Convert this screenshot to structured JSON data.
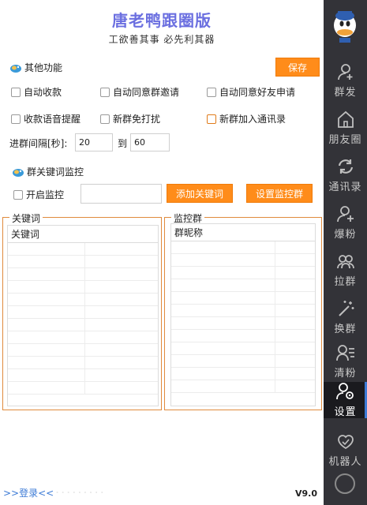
{
  "header": {
    "title": "唐老鸭跟圈版",
    "subtitle": "工欲善其事 必先利其器"
  },
  "other_functions": {
    "title": "其他功能",
    "save_label": "保存",
    "options": [
      {
        "label": "自动收款",
        "checked": false
      },
      {
        "label": "自动同意群邀请",
        "checked": false
      },
      {
        "label": "自动同意好友申请",
        "checked": false
      },
      {
        "label": "收款语音提醒",
        "checked": false
      },
      {
        "label": "新群免打扰",
        "checked": false
      },
      {
        "label": "新群加入通讯录",
        "checked": false
      }
    ],
    "interval_label": "进群间隔[秒]:",
    "interval_from": "20",
    "interval_to_label": "到",
    "interval_to": "60"
  },
  "keyword_monitor": {
    "title": "群关键词监控",
    "enable_label": "开启监控",
    "keyword_input": "",
    "add_keyword_label": "添加关键词",
    "set_group_label": "设置监控群"
  },
  "keywords_group": {
    "title": "关键词",
    "column": "关键词"
  },
  "monitor_group": {
    "title": "监控群",
    "column": "群昵称"
  },
  "sidebar": {
    "items": [
      {
        "label": "群发",
        "icon": "user-plus-icon"
      },
      {
        "label": "朋友圈",
        "icon": "home-icon"
      },
      {
        "label": "通讯录",
        "icon": "sync-icon"
      },
      {
        "label": "爆粉",
        "icon": "add-user-icon"
      },
      {
        "label": "拉群",
        "icon": "group-icon"
      },
      {
        "label": "换群",
        "icon": "sparkle-icon"
      },
      {
        "label": "清粉",
        "icon": "user-list-icon"
      },
      {
        "label": "设置",
        "icon": "user-settings-icon",
        "active": true
      },
      {
        "label": "机器人",
        "icon": "robot-icon"
      }
    ]
  },
  "footer": {
    "login": ">>登录<<",
    "version": "V9.0"
  },
  "colors": {
    "accent": "#ff8c1a",
    "title": "#6b6fe0",
    "sidebar": "#333338",
    "active_bar": "#3d7bd6"
  }
}
